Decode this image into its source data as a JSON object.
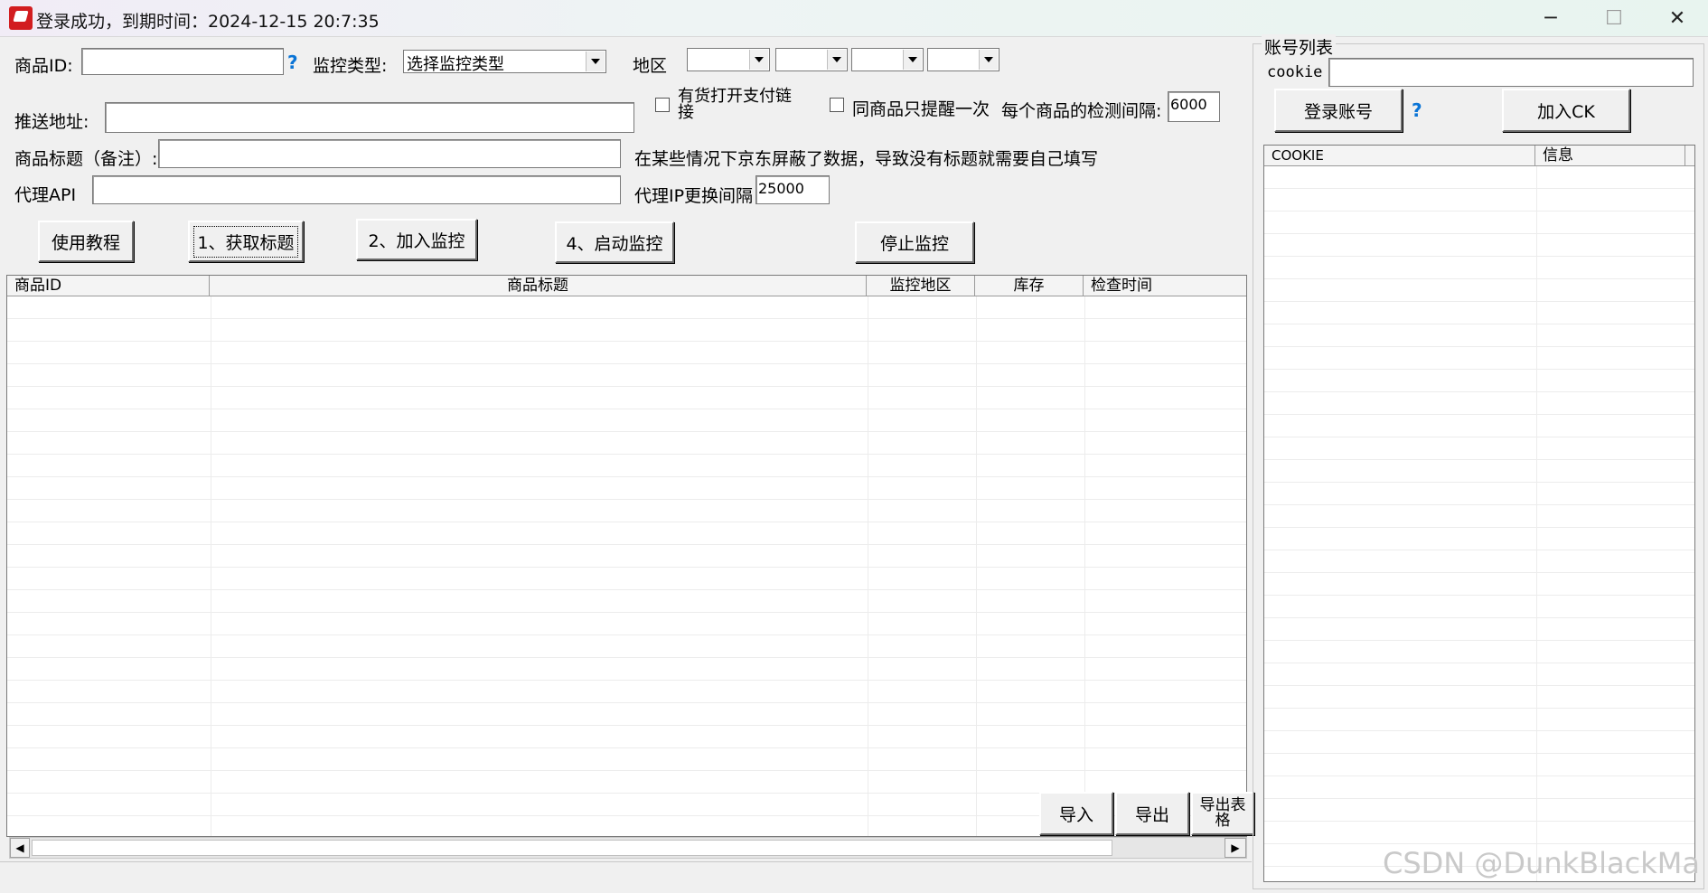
{
  "window": {
    "title": "登录成功，到期时间：2024-12-15 20:7:35",
    "minimize": "─",
    "maximize": "☐",
    "close": "✕"
  },
  "form": {
    "product_id_label": "商品ID:",
    "product_id_value": "",
    "help_mark": "?",
    "monitor_type_label": "监控类型:",
    "monitor_type_value": "选择监控类型",
    "region_label": "地区",
    "push_address_label": "推送地址:",
    "push_address_value": "",
    "open_pay_link_label": "有货打开支付链接",
    "remind_once_label": "同商品只提醒一次",
    "interval_label": "每个商品的检测间隔:",
    "interval_value": "6000",
    "product_title_label": "商品标题（备注）:",
    "product_title_value": "",
    "hint_text": "在某些情况下京东屏蔽了数据，导致没有标题就需要自己填写",
    "proxy_api_label": "代理API",
    "proxy_api_value": "",
    "proxy_interval_label": "代理IP更换间隔",
    "proxy_interval_value": "25000"
  },
  "buttons": {
    "tutorial": "使用教程",
    "get_title": "1、获取标题",
    "add_monitor": "2、加入监控",
    "start_monitor": "4、启动监控",
    "stop_monitor": "停止监控",
    "import": "导入",
    "export": "导出",
    "export_table": "导出表格"
  },
  "main_table": {
    "columns": [
      "商品ID",
      "商品标题",
      "监控地区",
      "库存",
      "检查时间"
    ],
    "rows": []
  },
  "accounts": {
    "group_title": "账号列表",
    "cookie_label": "cookie",
    "cookie_value": "",
    "login_button": "登录账号",
    "help_mark": "?",
    "add_ck_button": "加入CK",
    "columns": [
      "COOKIE",
      "信息"
    ],
    "rows": []
  },
  "icons": {
    "app": "app-logo-icon",
    "scroll_left": "◀",
    "scroll_right": "▶"
  },
  "watermark": "CSDN @DunkBlackMa"
}
